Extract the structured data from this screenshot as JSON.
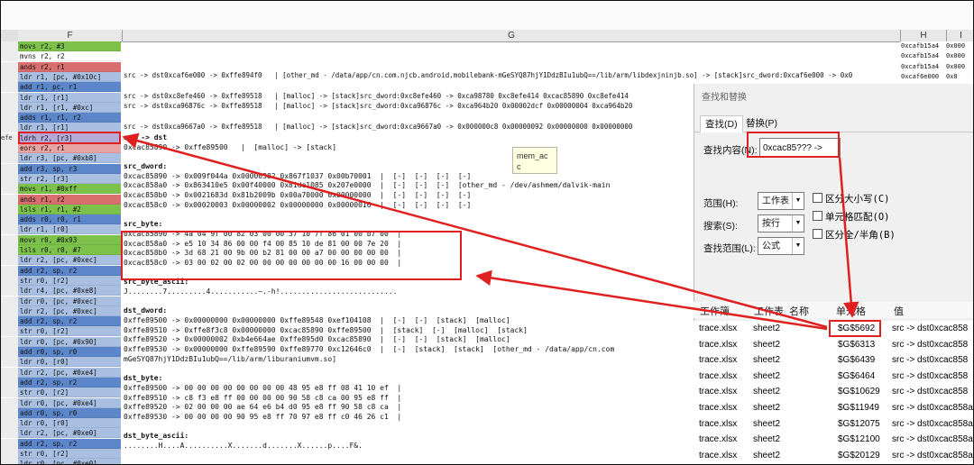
{
  "columns": {
    "f": "F",
    "g": "G",
    "h": "H",
    "i": "I"
  },
  "rows": [
    {
      "num": "",
      "f": "movs r2, #3",
      "c": "gr",
      "h": "0xcafb15a4",
      "i": "0x000"
    },
    {
      "num": "",
      "f": "mvns r2, r2",
      "c": "wh",
      "h": "0xcafb15a4",
      "i": "0x000"
    },
    {
      "num": "",
      "f": "ands r2, r1",
      "c": "rd",
      "h": "0xcafb15a4",
      "i": "0x000"
    },
    {
      "num": "",
      "f": "ldr r1, [pc, #0x10c]",
      "c": "lb",
      "h": "0xcaf6e000",
      "i": "0x0"
    },
    {
      "num": "",
      "f": "add r1, pc, r1",
      "c": "bl",
      "h": "",
      "i": ""
    },
    {
      "num": "",
      "f": "ldr r1, [r1]",
      "c": "lb",
      "h": "",
      "i": ""
    },
    {
      "num": "",
      "f": "ldr r1, [r1, #0xc]",
      "c": "lb",
      "h": "",
      "i": ""
    },
    {
      "num": "",
      "f": "adds r1, r1, r2",
      "c": "bl",
      "h": "",
      "i": ""
    },
    {
      "num": "",
      "f": "ldr r1, [r1]",
      "c": "lb",
      "h": "",
      "i": ""
    },
    {
      "num": "efe",
      "f": "ldrh r2, [r3]",
      "c": "lv",
      "h": "",
      "i": ""
    },
    {
      "num": "",
      "f": "eors r2, r1",
      "c": "pk",
      "h": "",
      "i": ""
    },
    {
      "num": "",
      "f": "ldr r3, [pc, #0xb8]",
      "c": "lb",
      "h": "",
      "i": ""
    },
    {
      "num": "",
      "f": "add r3, sp, r3",
      "c": "bl",
      "h": "",
      "i": ""
    },
    {
      "num": "",
      "f": "str r2, [r3]",
      "c": "lb",
      "h": "",
      "i": ""
    },
    {
      "num": "",
      "f": "movs r1, #0xff",
      "c": "gr",
      "h": "",
      "i": ""
    },
    {
      "num": "",
      "f": "ands r1, r2",
      "c": "rd",
      "h": "",
      "i": ""
    },
    {
      "num": "",
      "f": "lsls r1, r1, #2",
      "c": "gr",
      "h": "",
      "i": ""
    },
    {
      "num": "",
      "f": "adds r0, r0, r1",
      "c": "bl",
      "h": "",
      "i": ""
    },
    {
      "num": "",
      "f": "ldr r1, [r0]",
      "c": "lb",
      "h": "",
      "i": ""
    },
    {
      "num": "",
      "f": "movs r0, #0x93",
      "c": "gr",
      "h": "",
      "i": ""
    },
    {
      "num": "",
      "f": "lsls r0, r0, #7",
      "c": "gr",
      "h": "",
      "i": ""
    },
    {
      "num": "",
      "f": "ldr r2, [pc, #0xec]",
      "c": "lb",
      "h": "",
      "i": ""
    },
    {
      "num": "",
      "f": "add r2, sp, r2",
      "c": "bl",
      "h": "",
      "i": ""
    },
    {
      "num": "",
      "f": "str r0, [r2]",
      "c": "lb",
      "h": "",
      "i": ""
    },
    {
      "num": "",
      "f": "ldr r4, [pc, #0xe8]",
      "c": "lb",
      "h": "",
      "i": ""
    },
    {
      "num": "",
      "f": "ldr r0, [pc, #0xec]",
      "c": "lb",
      "h": "",
      "i": ""
    },
    {
      "num": "",
      "f": "ldr r2, [pc, #0xec]",
      "c": "lb",
      "h": "",
      "i": ""
    },
    {
      "num": "",
      "f": "add r2, sp, r2",
      "c": "bl",
      "h": "",
      "i": ""
    },
    {
      "num": "",
      "f": "str r0, [r2]",
      "c": "lb",
      "h": "",
      "i": ""
    },
    {
      "num": "",
      "f": "ldr r0, [pc, #0x90]",
      "c": "lb",
      "h": "",
      "i": ""
    },
    {
      "num": "",
      "f": "add r0, sp, r0",
      "c": "bl",
      "h": "",
      "i": ""
    },
    {
      "num": "",
      "f": "ldr r0, [r0]",
      "c": "lb",
      "h": "",
      "i": ""
    },
    {
      "num": "",
      "f": "ldr r2, [pc, #0xe4]",
      "c": "lb",
      "h": "",
      "i": ""
    },
    {
      "num": "",
      "f": "add r2, sp, r2",
      "c": "bl",
      "h": "",
      "i": ""
    },
    {
      "num": "",
      "f": "str r0, [r2]",
      "c": "lb",
      "h": "",
      "i": ""
    },
    {
      "num": "",
      "f": "ldr r0, [pc, #0xe4]",
      "c": "lb",
      "h": "",
      "i": ""
    },
    {
      "num": "",
      "f": "add r0, sp, r0",
      "c": "bl",
      "h": "",
      "i": ""
    },
    {
      "num": "",
      "f": "ldr r0, [r0]",
      "c": "lb",
      "h": "",
      "i": ""
    },
    {
      "num": "",
      "f": "ldr r2, [pc, #0xe0]",
      "c": "lb",
      "h": "",
      "i": ""
    },
    {
      "num": "",
      "f": "add r2, sp, r2",
      "c": "bl",
      "h": "",
      "i": ""
    },
    {
      "num": "",
      "f": "str r0, [r2]",
      "c": "lb",
      "h": "",
      "i": ""
    },
    {
      "num": "",
      "f": "ldr r0, [pc, #0xe0]",
      "c": "lb",
      "h": "",
      "i": ""
    }
  ],
  "g_top_lines": [
    "src -> dst0xcaf6e000 -> 0xffe894f0   | [other_md - /data/app/cn.com.njcb.android.mobilebank-mGeSYQ87hjY1DdzBIu1ubQ==/lib/arm/libdexjninjb.so] -> [stack]src_dword:0xcaf6e000 -> 0x0",
    "",
    "src -> dst0xc8efe460 -> 0xffe89518   | [malloc] -> [stack]src_dword:0xc8efe460 -> 0xca98780 0xc8efe414 0xcac85890 0xc8efe414",
    "src -> dst0xca96876c -> 0xffe89518   | [malloc] -> [stack]src_dword:0xca96876c -> 0xca964b20 0x00002dcf 0x00000004 0xca964b20",
    "",
    "src -> dst0xca9667a0 -> 0xffe89518   | [malloc] -> [stack]src_dword:0xca9667a0 -> 0x000000c8 0x00000092 0x00000000 0x00000000"
  ],
  "g_main_lines": [
    "src -> dst",
    "0xcac85890 -> 0xffe89500   |  [malloc] -> [stack]",
    "",
    "src_dword:",
    "0xcac85890 -> 0x009f044a 0x00000382 0x867f1037 0x00b70001  |  [-]  [-]  [-]  [-]",
    "0xcac858a0 -> 0x863410e5 0x00f40000 0x81de1085 0x207e0000  |  [-]  [-]  [-]  [other_md - /dev/ashmem/dalvik-main",
    "0xcac858b0 -> 0x0021683d 0x81b2009b 0x00a70000 0x00000000  |  [-]  [-]  [-]  [-]",
    "0xcac858c0 -> 0x00020003 0x00000002 0x00000000 0x00000016  |  [-]  [-]  [-]  [-]",
    "",
    "src_byte:",
    "0xcac85890 -> 4a 04 9f 00 82 03 00 00 37 10 7f 86 01 00 b7 00  |",
    "0xcac858a0 -> e5 10 34 86 00 00 f4 00 85 10 de 81 00 00 7e 20  |",
    "0xcac858b0 -> 3d 68 21 00 9b 00 b2 81 00 00 a7 00 00 00 00 00  |",
    "0xcac858c0 -> 03 00 02 00 02 00 00 00 00 00 00 00 16 00 00 00  |",
    "",
    "src_byte_ascii:",
    "J........7.........4...........~.-h!...........................",
    "",
    "dst_dword:",
    "0xffe89500 -> 0x00000000 0x00000000 0xffe89548 0xef104108  |  [-]  [-]  [stack]  [malloc]",
    "0xffe89510 -> 0xffe8f3c8 0x00000000 0xcac85890 0xffe89500  |  [stack]  [-]  [malloc]  [stack]",
    "0xffe89520 -> 0x00000002 0xb4e664ae 0xffe895d0 0xcac85890  |  [-]  [-]  [stack]  [malloc]",
    "0xffe89530 -> 0x00000000 0xffe89590 0xffe89770 0xc12646c0  |  [-]  [stack]  [stack]  [other_md - /data/app/cn.com",
    "mGeSYQ87hjY1DdzBIu1ubQ==/lib/arm/liburaniumvm.so]",
    "",
    "dst_byte:",
    "0xffe89500 -> 00 00 00 00 00 00 00 00 48 95 e8 ff 08 41 10 ef  |",
    "0xffe89510 -> c8 f3 e8 ff 00 00 00 00 90 58 c8 ca 00 95 e8 ff  |",
    "0xffe89520 -> 02 00 00 00 ae 64 e6 b4 d0 95 e8 ff 90 58 c8 ca  |",
    "0xffe89530 -> 00 00 00 00 90 95 e8 ff 70 97 e8 ff c0 46 26 c1  |",
    "",
    "dst_byte_ascii:",
    "........H....A..........X.......d.......X......p....F&."
  ],
  "tooltip": "mem_ac\nc",
  "dialog": {
    "title": "查找和替换",
    "tab_find": "查找(D)",
    "tab_replace": "替换(P)",
    "find_label": "查找内容(N):",
    "find_value": "0xcac85??? ->",
    "scope_label": "范围(H):",
    "scope_value": "工作表",
    "search_label": "搜索(S):",
    "search_value": "按行",
    "lookin_label": "查找范围(L):",
    "lookin_value": "公式",
    "opt_case": "区分大小写(C)",
    "opt_cell": "单元格匹配(O)",
    "opt_width": "区分全/半角(B)"
  },
  "results": {
    "headers": [
      "工作簿",
      "工作表",
      "名称",
      "单元格",
      "值"
    ],
    "rows": [
      {
        "book": "trace.xlsx",
        "sheet": "sheet2",
        "cell": "$G$5692",
        "value": "src -> dst0xcac858"
      },
      {
        "book": "trace.xlsx",
        "sheet": "sheet2",
        "cell": "$G$6313",
        "value": "src -> dst0xcac858"
      },
      {
        "book": "trace.xlsx",
        "sheet": "sheet2",
        "cell": "$G$6439",
        "value": "src -> dst0xcac858"
      },
      {
        "book": "trace.xlsx",
        "sheet": "sheet2",
        "cell": "$G$6464",
        "value": "src -> dst0xcac858"
      },
      {
        "book": "trace.xlsx",
        "sheet": "sheet2",
        "cell": "$G$10629",
        "value": "src -> dst0xcac858"
      },
      {
        "book": "trace.xlsx",
        "sheet": "sheet2",
        "cell": "$G$11949",
        "value": "src -> dst0xcac858a"
      },
      {
        "book": "trace.xlsx",
        "sheet": "sheet2",
        "cell": "$G$12075",
        "value": "src -> dst0xcac858a"
      },
      {
        "book": "trace.xlsx",
        "sheet": "sheet2",
        "cell": "$G$12100",
        "value": "src -> dst0xcac858a"
      },
      {
        "book": "trace.xlsx",
        "sheet": "sheet2",
        "cell": "$G$20129",
        "value": "src -> dst0xcac858a"
      }
    ]
  },
  "colors": {
    "annotation": "#e02020",
    "green": "#7cc24a",
    "blue": "#5b86c9",
    "red": "#d96e6e",
    "lavender": "#b5a9d8"
  }
}
